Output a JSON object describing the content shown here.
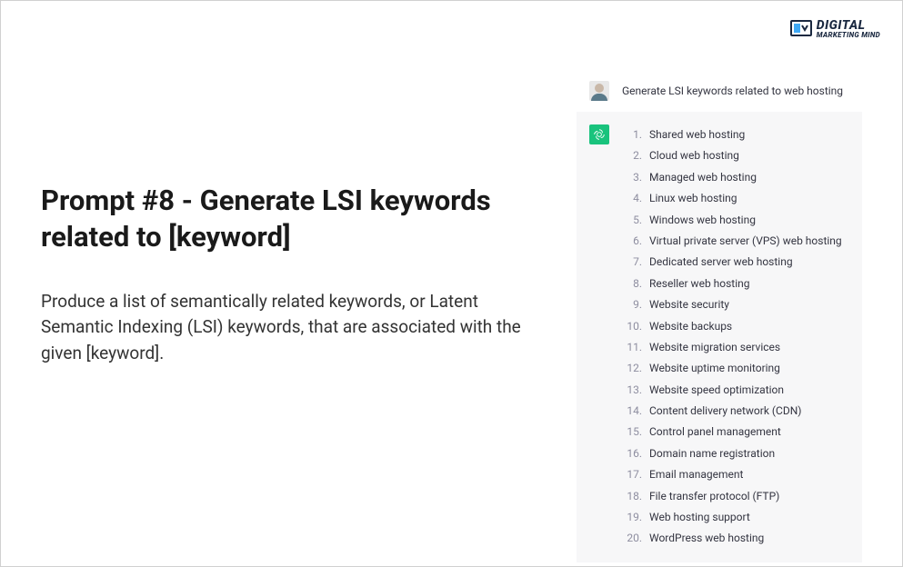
{
  "logo": {
    "line1": "DIGITAL",
    "line2": "MARKETING MIND"
  },
  "heading": "Prompt #8 - Generate LSI keywords related to [keyword]",
  "description": "Produce a list of semantically related keywords, or Latent Semantic Indexing (LSI) keywords, that are associated with the given [keyword].",
  "chat": {
    "user_prompt": "Generate LSI keywords related to web hosting",
    "keywords": [
      "Shared web hosting",
      "Cloud web hosting",
      "Managed web hosting",
      "Linux web hosting",
      "Windows web hosting",
      "Virtual private server (VPS) web hosting",
      "Dedicated server web hosting",
      "Reseller web hosting",
      "Website security",
      "Website backups",
      "Website migration services",
      "Website uptime monitoring",
      "Website speed optimization",
      "Content delivery network (CDN)",
      "Control panel management",
      "Domain name registration",
      "Email management",
      "File transfer protocol (FTP)",
      "Web hosting support",
      "WordPress web hosting"
    ]
  }
}
